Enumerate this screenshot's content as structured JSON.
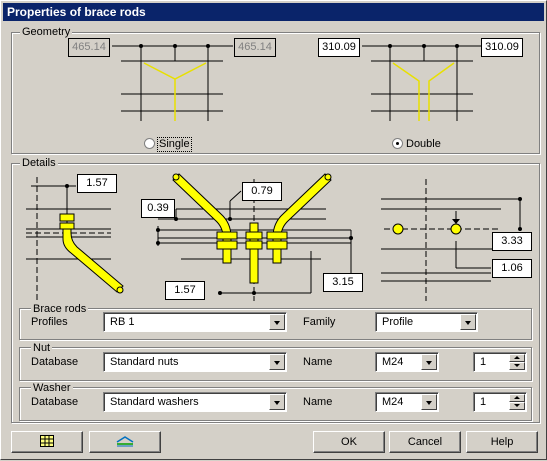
{
  "window": {
    "title": "Properties of brace rods"
  },
  "geometry": {
    "group_label": "Geometry",
    "single": {
      "left_value": "465.14",
      "right_value": "465.14",
      "option_label": "Single",
      "selected": false
    },
    "double": {
      "left_value": "310.09",
      "right_value": "310.09",
      "option_label": "Double",
      "selected": true
    }
  },
  "details": {
    "group_label": "Details",
    "dims": {
      "d1": "1.57",
      "d2": "0.79",
      "d3": "0.39",
      "d4": "1.57",
      "d5": "3.15",
      "d6": "3.33",
      "d7": "1.06"
    }
  },
  "brace_rods": {
    "group_label": "Brace rods",
    "profiles_label": "Profiles",
    "profiles_value": "RB 1",
    "family_label": "Family",
    "family_value": "Profile"
  },
  "nut": {
    "group_label": "Nut",
    "database_label": "Database",
    "database_value": "Standard nuts",
    "name_label": "Name",
    "name_value": "M24",
    "quantity": "1"
  },
  "washer": {
    "group_label": "Washer",
    "database_label": "Database",
    "database_value": "Standard washers",
    "name_label": "Name",
    "name_value": "M24",
    "quantity": "1"
  },
  "buttons": {
    "ok": "OK",
    "cancel": "Cancel",
    "help": "Help"
  },
  "icons": {
    "left_tool": "grid-properties-icon",
    "right_tool": "layer-stack-icon"
  },
  "colors": {
    "title_bar": "#0a246a",
    "rod": "#ffff00",
    "background": "#d4d0c8"
  }
}
